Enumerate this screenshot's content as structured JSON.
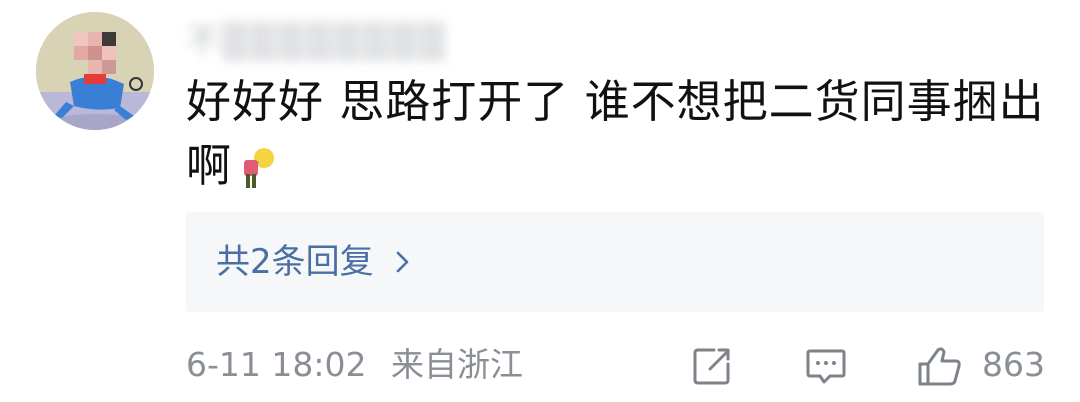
{
  "comment": {
    "username_obscured": "不▒▒▒▒▒▒▒▒",
    "text": "好好好 思路打开了 谁不想把二货同事捆出啊",
    "emoji_name": "bowing-figure-with-lightbulb-head",
    "replies_label": "共2条回复",
    "date": "6-11 18:02",
    "location": "来自浙江",
    "like_count": "863"
  },
  "icons": {
    "reply_chevron": "chevron-right-icon",
    "share": "share-icon",
    "comment": "comment-icon",
    "like": "thumbs-up-icon"
  },
  "colors": {
    "link": "#4a6fa5",
    "meta_text": "#8a8f96",
    "reply_bg": "#f6f7f8",
    "body_text": "#111111"
  }
}
